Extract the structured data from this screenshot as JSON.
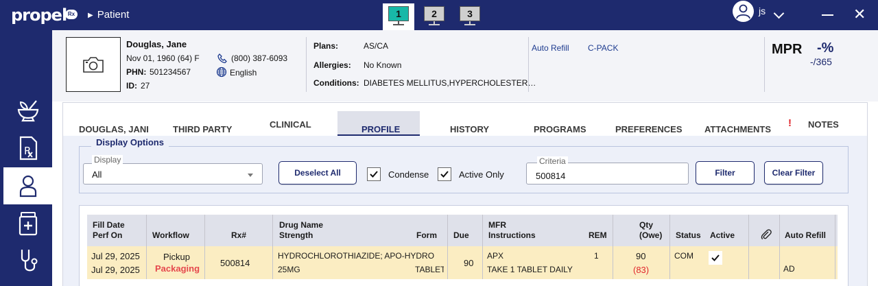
{
  "app": {
    "logo_text": "propel",
    "logo_badge": "Rx",
    "breadcrumb": "Patient",
    "workstations": [
      "1",
      "2",
      "3"
    ],
    "active_workstation": "1",
    "user_initials": "js"
  },
  "patient": {
    "name": "Douglas, Jane",
    "dob": "Nov 01, 1960 (64) F",
    "phn_label": "PHN:",
    "phn": "501234567",
    "id_label": "ID:",
    "id": "27",
    "phone": "(800) 387-6093",
    "language": "English",
    "plans_label": "Plans:",
    "plans": "AS/CA",
    "allergies_label": "Allergies:",
    "allergies": "No Known",
    "conditions_label": "Conditions:",
    "conditions": "DIABETES MELLITUS,HYPERCHOLESTER…",
    "auto_refill_link": "Auto Refill",
    "cpack_link": "C-PACK",
    "mpr_label": "MPR",
    "mpr_value": "-%",
    "mpr_days": "-/365"
  },
  "tabs": [
    "DOUGLAS, JANI",
    "THIRD PARTY",
    "CLINICAL",
    "PROFILE",
    "HISTORY",
    "PROGRAMS",
    "PREFERENCES",
    "ATTACHMENTS",
    "NOTES"
  ],
  "active_tab": "PROFILE",
  "attachments_alert": "!",
  "display_options": {
    "legend": "Display Options",
    "display_label": "Display",
    "display_value": "All",
    "deselect_all": "Deselect All",
    "condense_label": "Condense",
    "condense_checked": true,
    "active_only_label": "Active Only",
    "active_only_checked": true,
    "criteria_label": "Criteria",
    "criteria_value": "500814",
    "filter_button": "Filter",
    "clear_filter_button": "Clear Filter"
  },
  "table": {
    "headers": {
      "fill_date": "Fill Date",
      "perf_on": "Perf On",
      "workflow": "Workflow",
      "rx": "Rx#",
      "drug_name": "Drug Name",
      "strength": "Strength",
      "form": "Form",
      "due": "Due",
      "mfr": "MFR",
      "instructions": "Instructions",
      "rem": "REM",
      "qty": "Qty",
      "owe": "(Owe)",
      "status": "Status",
      "active": "Active",
      "auto_refill": "Auto Refill"
    },
    "rows": [
      {
        "fill_date": "Jul 29, 2025",
        "perf_on": "Jul 29, 2025",
        "workflow_top": "Pickup",
        "workflow_bottom": "Packaging",
        "rx": "500814",
        "drug_name": "HYDROCHLOROTHIAZIDE; APO-HYDRO",
        "strength": "25MG",
        "form": "TABLET",
        "due": "90",
        "mfr": "APX",
        "instructions": "TAKE 1 TABLET DAILY",
        "rem": "1",
        "qty": "90",
        "owe": "(83)",
        "status": "COM",
        "active": true,
        "auto_refill": "AD"
      }
    ]
  }
}
